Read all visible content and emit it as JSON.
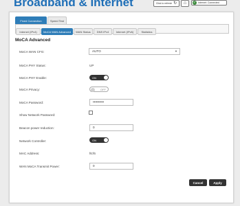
{
  "header": {
    "title": "Broadband & Internet",
    "refresh_label": "Click to refresh",
    "status_label": "Internet: Connected"
  },
  "top_tabs": [
    {
      "label": "Fixed Connection",
      "active": true
    },
    {
      "label": "Speed Test",
      "active": false
    }
  ],
  "sub_tabs": [
    {
      "label": "Internet (IPv4)",
      "active": false
    },
    {
      "label": "MoCA WAN Advanced",
      "active": true
    },
    {
      "label": "WAN Status",
      "active": false
    },
    {
      "label": "DNS IPv4",
      "active": false
    },
    {
      "label": "Internet (IPv6)",
      "active": false
    },
    {
      "label": "Statistics",
      "active": false
    }
  ],
  "section": {
    "title": "MoCA Advanced"
  },
  "fields": {
    "wan_cfg": {
      "label": "MoCA WAN CFG:",
      "value": "AUTO"
    },
    "phy_status": {
      "label": "MoCA PHY Status:",
      "value": "UP"
    },
    "phy_enable": {
      "label": "MoCA PHY Enable:",
      "value": "ON"
    },
    "privacy": {
      "label": "MoCA Privacy:",
      "value": "OFF"
    },
    "password": {
      "label": "MoCA Password:",
      "value": "••••••••••"
    },
    "show_password": {
      "label": "Show Network Password:"
    },
    "beacon": {
      "label": "Beacon power reduction:",
      "value": "0"
    },
    "net_controller": {
      "label": "Network Controller:",
      "value": "ON"
    },
    "mac": {
      "label": "MAC Address:",
      "value": "f6:f6"
    },
    "tx_power": {
      "label": "WAN MoCA Transmit Power:",
      "value": "0"
    }
  },
  "actions": {
    "cancel": "Cancel",
    "apply": "Apply"
  }
}
